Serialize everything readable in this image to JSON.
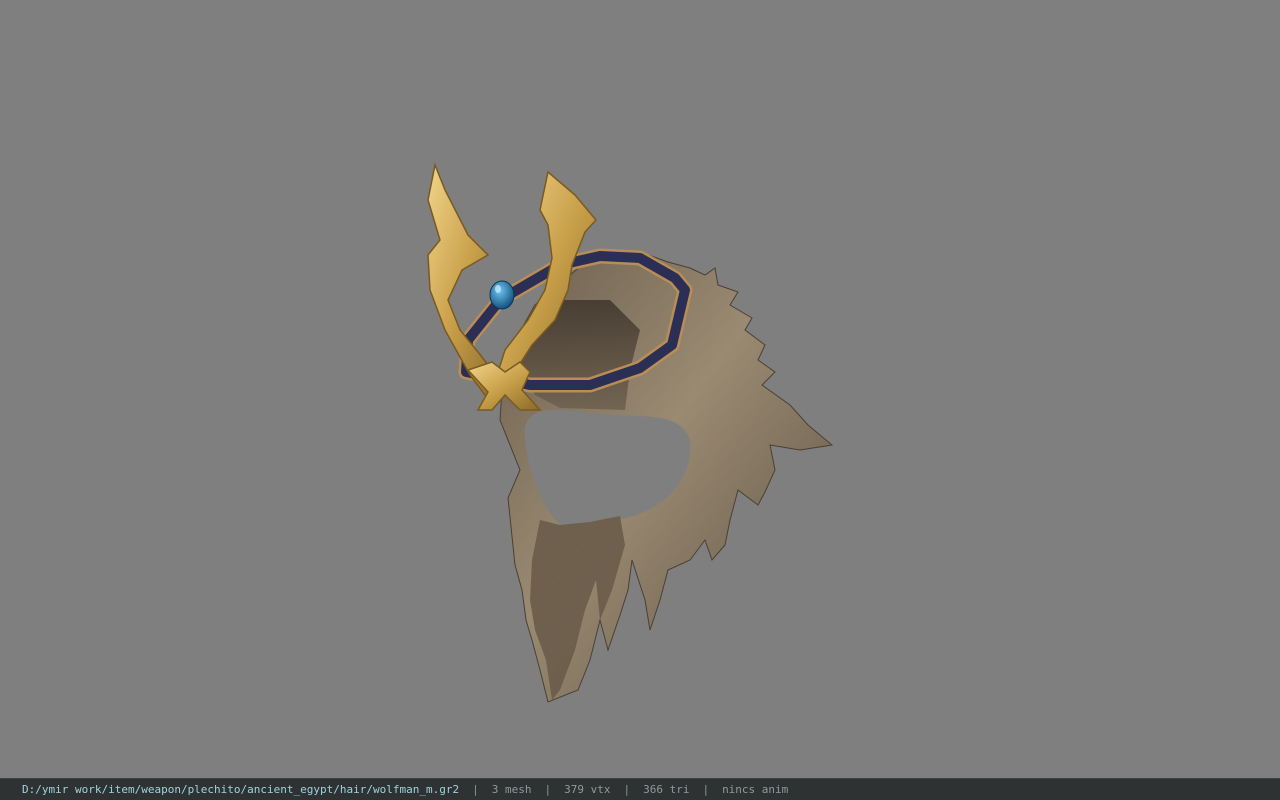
{
  "status": {
    "file_path": "D:/ymir work/item/weapon/plechito/ancient_egypt/hair/wolfman_m.gr2",
    "separator": "|",
    "mesh": "3 mesh",
    "vertices": "379 vtx",
    "triangles": "366 tri",
    "animation": "nincs anim"
  },
  "colors": {
    "background": "#7f7f7f",
    "statusbar": "#2e3233",
    "path_text": "#9fd3dc",
    "stat_text": "#8f9a9b",
    "hair": "#8a7a64",
    "gold": "#d4ae5a",
    "band": "#2b2f55",
    "gem": "#1c6aa0"
  }
}
